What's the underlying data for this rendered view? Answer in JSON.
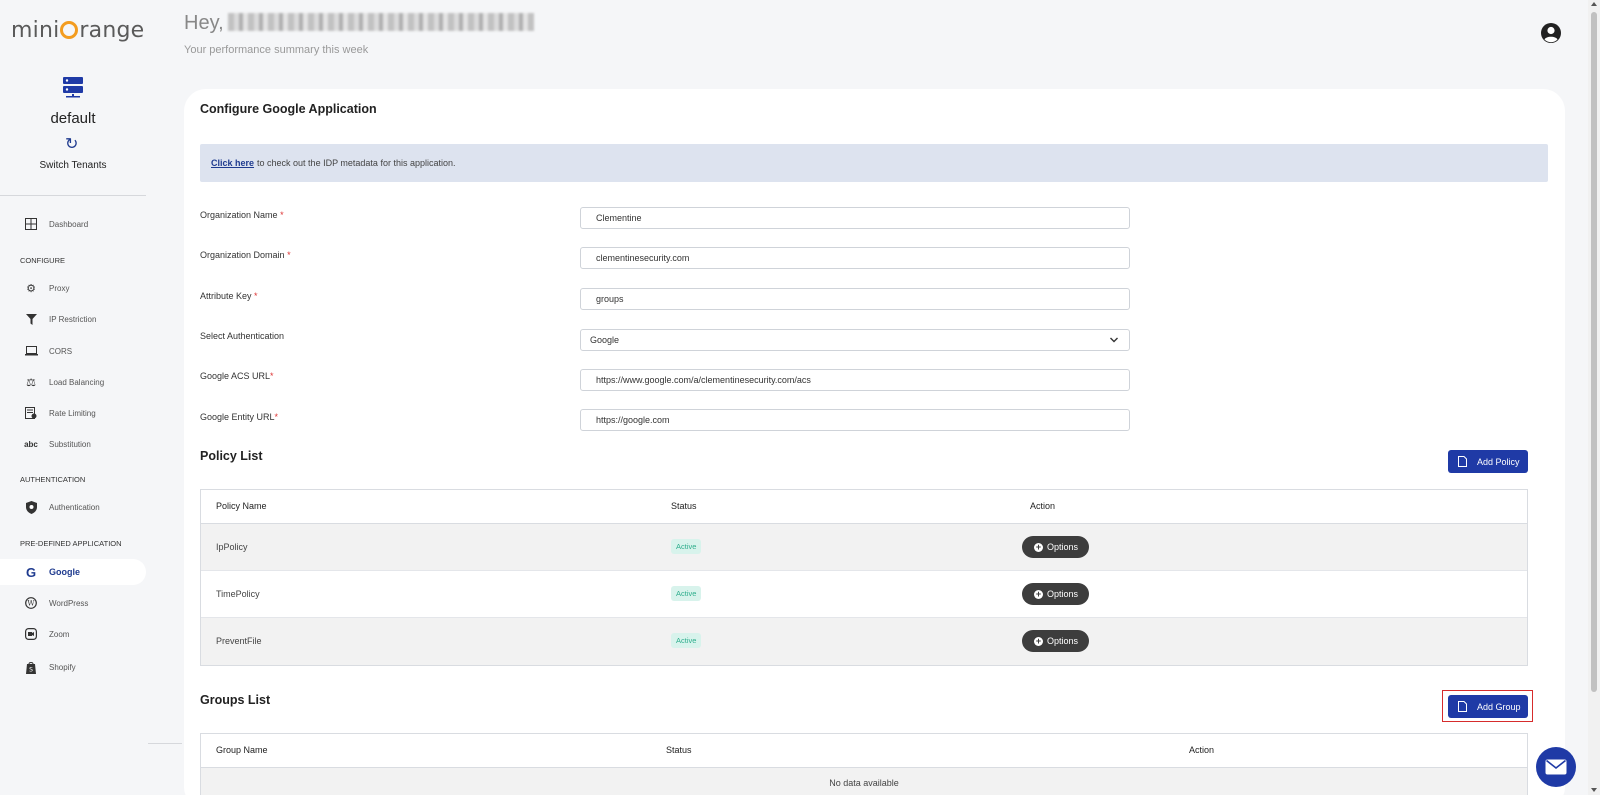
{
  "brand": {
    "logo_pre": "mini",
    "logo_post": "range"
  },
  "tenant": {
    "name": "default",
    "switch_label": "Switch Tenants"
  },
  "sidebar": {
    "dashboard": "Dashboard",
    "sections": {
      "configure": "CONFIGURE",
      "authentication": "AUTHENTICATION",
      "predefined": "PRE-DEFINED APPLICATION"
    },
    "configure_items": [
      "Proxy",
      "IP Restriction",
      "CORS",
      "Load Balancing",
      "Rate Limiting",
      "Substitution"
    ],
    "auth_items": [
      "Authentication"
    ],
    "app_items": [
      "Google",
      "WordPress",
      "Zoom",
      "Shopify"
    ],
    "active_item": "Google"
  },
  "header": {
    "greeting": "Hey,",
    "subtitle": "Your performance summary this week"
  },
  "page": {
    "title": "Configure Google Application",
    "info_link": "Click here",
    "info_text": "to check out the IDP metadata for this application."
  },
  "form": {
    "org_name": {
      "label": "Organization Name",
      "required": "*",
      "value": "Clementine"
    },
    "org_domain": {
      "label": "Organization Domain",
      "required": "*",
      "value": "clementinesecurity.com"
    },
    "attr_key": {
      "label": "Attribute Key",
      "required": "*",
      "value": "groups"
    },
    "select_auth": {
      "label": "Select Authentication",
      "value": "Google"
    },
    "acs_url": {
      "label": "Google ACS URL",
      "required": "*",
      "value": "https://www.google.com/a/clementinesecurity.com/acs"
    },
    "entity_url": {
      "label": "Google Entity URL",
      "required": "*",
      "value": "https://google.com"
    }
  },
  "policy_list": {
    "title": "Policy List",
    "add_label": "Add Policy",
    "columns": [
      "Policy Name",
      "Status",
      "Action"
    ],
    "rows": [
      {
        "name": "IpPolicy",
        "status": "Active",
        "action": "Options"
      },
      {
        "name": "TimePolicy",
        "status": "Active",
        "action": "Options"
      },
      {
        "name": "PreventFile",
        "status": "Active",
        "action": "Options"
      }
    ]
  },
  "groups_list": {
    "title": "Groups List",
    "add_label": "Add Group",
    "columns": [
      "Group Name",
      "Status",
      "Action"
    ],
    "empty": "No data available"
  },
  "colors": {
    "primary": "#1f3aa6",
    "accent": "#f39c1f",
    "active_badge_bg": "#d8f3ec",
    "active_badge_text": "#2fae8d",
    "highlight": "#d62c2c"
  }
}
